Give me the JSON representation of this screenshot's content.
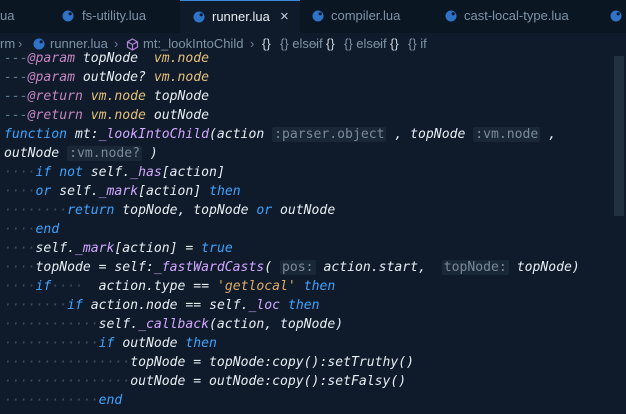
{
  "tabs": [
    {
      "label": "fs-utility.lua",
      "active": false
    },
    {
      "label": "runner.lua",
      "active": true
    },
    {
      "label": "compiler.lua",
      "active": false
    },
    {
      "label": "cast-local-type.lua",
      "active": false
    }
  ],
  "tab_close_glyph": "×",
  "first_tab_fragment": "ua",
  "breadcrumb": {
    "root_fragment": "rm",
    "file": "runner.lua",
    "symbol": "mt:_lookIntoChild",
    "items": [
      "{} elseif",
      "{} elseif",
      "{} if"
    ]
  },
  "code_lines": [
    "---@param topNode  vm.node",
    "---@param outNode? vm.node",
    "---@return vm.node topNode",
    "---@return vm.node outNode",
    "function mt:_lookIntoChild(action :parser.object , topNode :vm.node , ",
    "outNode :vm.node? )",
    "    if not self._has[action]",
    "    or self._mark[action] then",
    "        return topNode, topNode or outNode",
    "    end",
    "    self._mark[action] = true",
    "    topNode = self:_fastWardCasts( pos: action.start,  topNode: topNode)",
    "    if      action.type == 'getlocal' then",
    "        if action.node == self._loc then",
    "            self._callback(action, topNode)",
    "            if outNode then",
    "                topNode = topNode:copy():setTruthy()",
    "                outNode = outNode:copy():setFalsy()",
    "            end"
  ],
  "colors": {
    "background": "#0f1b2a",
    "tab_active_border": "#3b8ad8",
    "keyword": "#3fa3ff",
    "function": "#d2a7ff",
    "string": "#e0ab6a",
    "annotation": "#c586c0",
    "type": "#e5c07b"
  },
  "icons": [
    "lua-file-icon",
    "symbol-method-icon",
    "braces-icon",
    "chevron-right-icon"
  ]
}
